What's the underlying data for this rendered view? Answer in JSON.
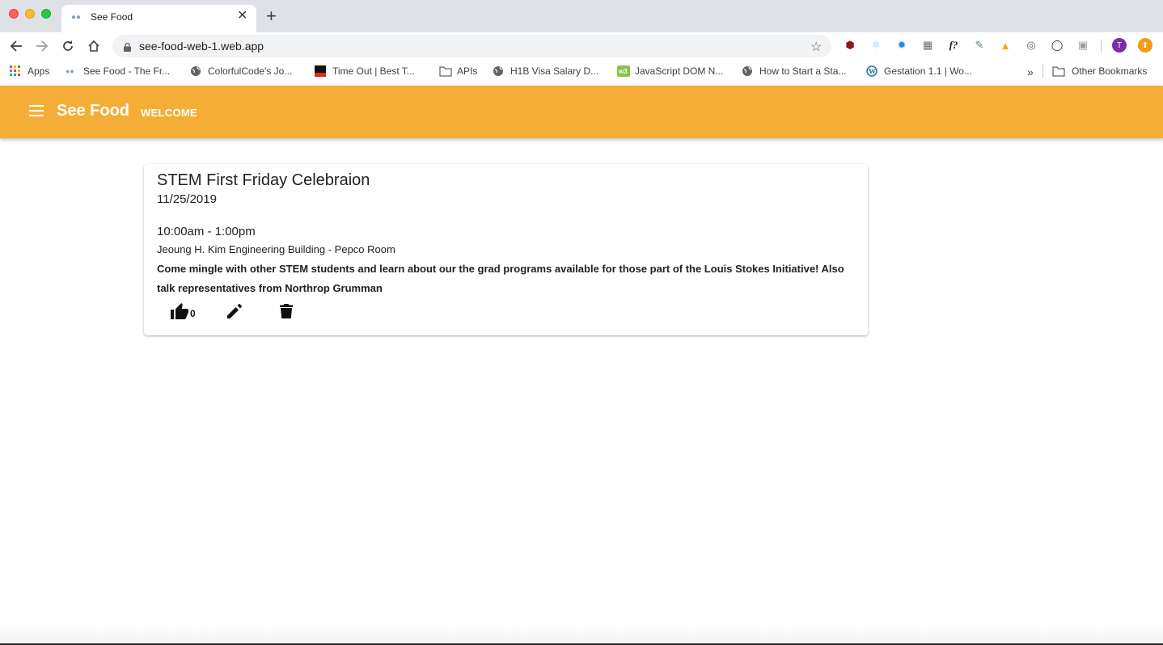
{
  "browser": {
    "tab_title": "See Food",
    "url": "see-food-web-1.web.app",
    "profile_initial": "T",
    "bookmarks": [
      {
        "label": "Apps",
        "icon": "apps-grid-icon"
      },
      {
        "label": "See Food - The Fr...",
        "icon": "seefood-favicon"
      },
      {
        "label": "ColorfulCode's Jo...",
        "icon": "globe-icon"
      },
      {
        "label": "Time Out | Best T...",
        "icon": "timeout-favicon"
      },
      {
        "label": "APIs",
        "icon": "folder-icon"
      },
      {
        "label": "H1B Visa Salary D...",
        "icon": "globe-icon"
      },
      {
        "label": "JavaScript DOM N...",
        "icon": "w3-favicon"
      },
      {
        "label": "How to Start a Sta...",
        "icon": "globe-icon"
      },
      {
        "label": "Gestation 1.1 | Wo...",
        "icon": "wordpress-icon"
      }
    ],
    "overflow_label": "»",
    "other_bookmarks": "Other Bookmarks",
    "new_tab_label": "+",
    "close_tab_label": "✕"
  },
  "app": {
    "brand": "See Food",
    "nav_welcome": "WELCOME",
    "accent_color": "#f4ae37"
  },
  "event": {
    "title": "STEM First Friday Celebraion",
    "date": "11/25/2019",
    "time": "10:00am - 1:00pm",
    "location": "Jeoung H. Kim Engineering Building - Pepco Room",
    "description": "Come mingle with other STEM students and learn about our the grad programs available for those part of the Louis Stokes Initiative! Also talk representatives from Northrop Grumman",
    "likes": "0"
  }
}
